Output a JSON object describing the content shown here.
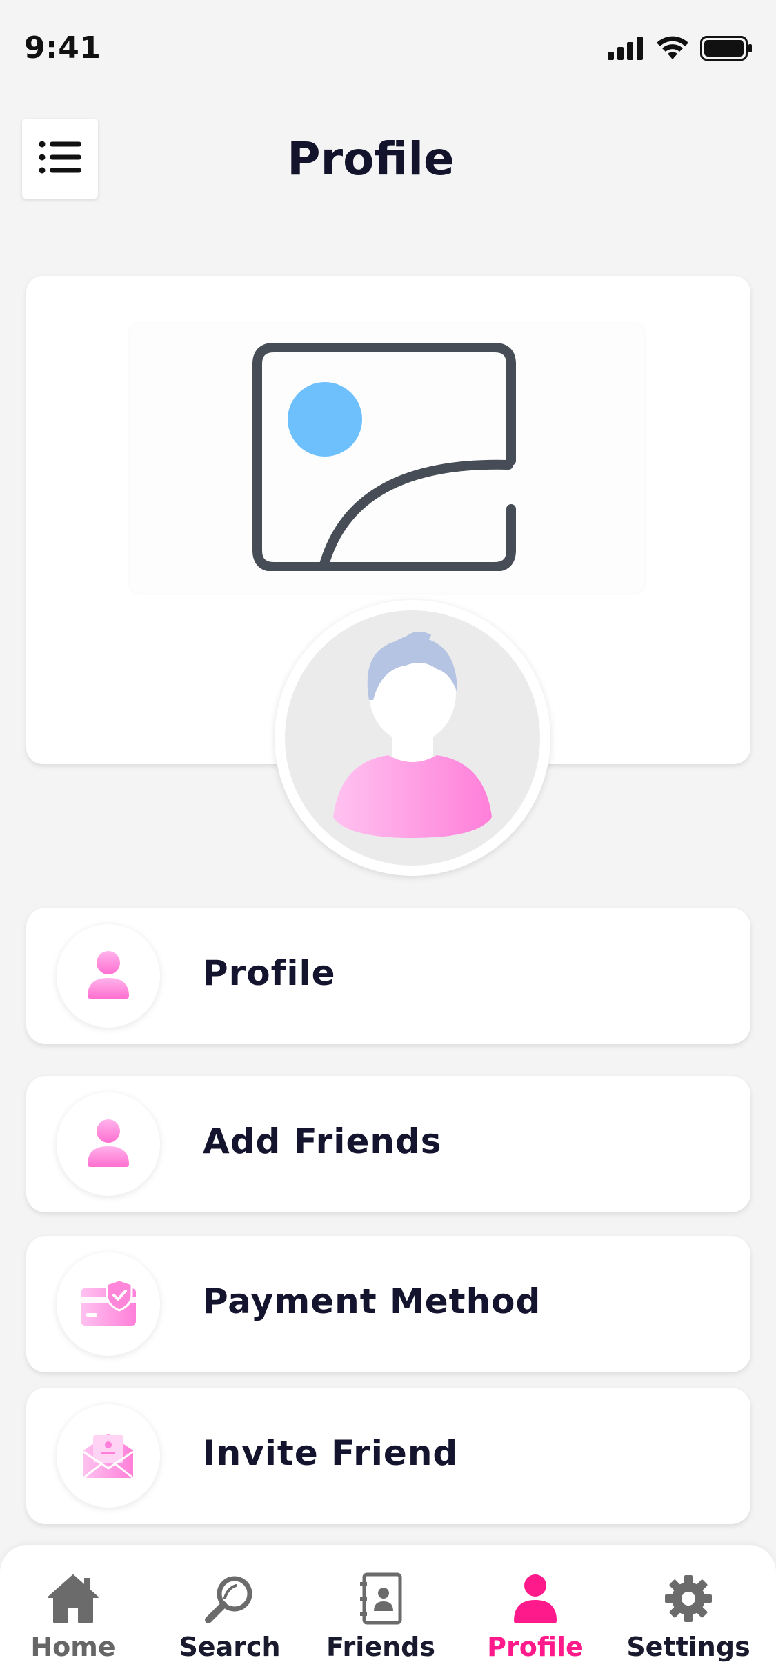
{
  "status_bar": {
    "time": "9:41"
  },
  "header": {
    "title": "Profile"
  },
  "menu": [
    {
      "label": "Profile",
      "icon": "user-icon"
    },
    {
      "label": "Add Friends",
      "icon": "add-user-icon"
    },
    {
      "label": "Payment Method",
      "icon": "payment-card-icon"
    },
    {
      "label": "Invite Friend",
      "icon": "invite-envelope-icon"
    }
  ],
  "tabs": [
    {
      "label": "Home",
      "icon": "home-icon",
      "active": false
    },
    {
      "label": "Search",
      "icon": "search-icon",
      "active": false
    },
    {
      "label": "Friends",
      "icon": "contacts-icon",
      "active": false
    },
    {
      "label": "Profile",
      "icon": "user-icon",
      "active": true
    },
    {
      "label": "Settings",
      "icon": "gear-icon",
      "active": false
    }
  ],
  "colors": {
    "accent": "#ff1a8c",
    "icon_pink": "#ff8fd8",
    "background": "#f4f4f5"
  }
}
